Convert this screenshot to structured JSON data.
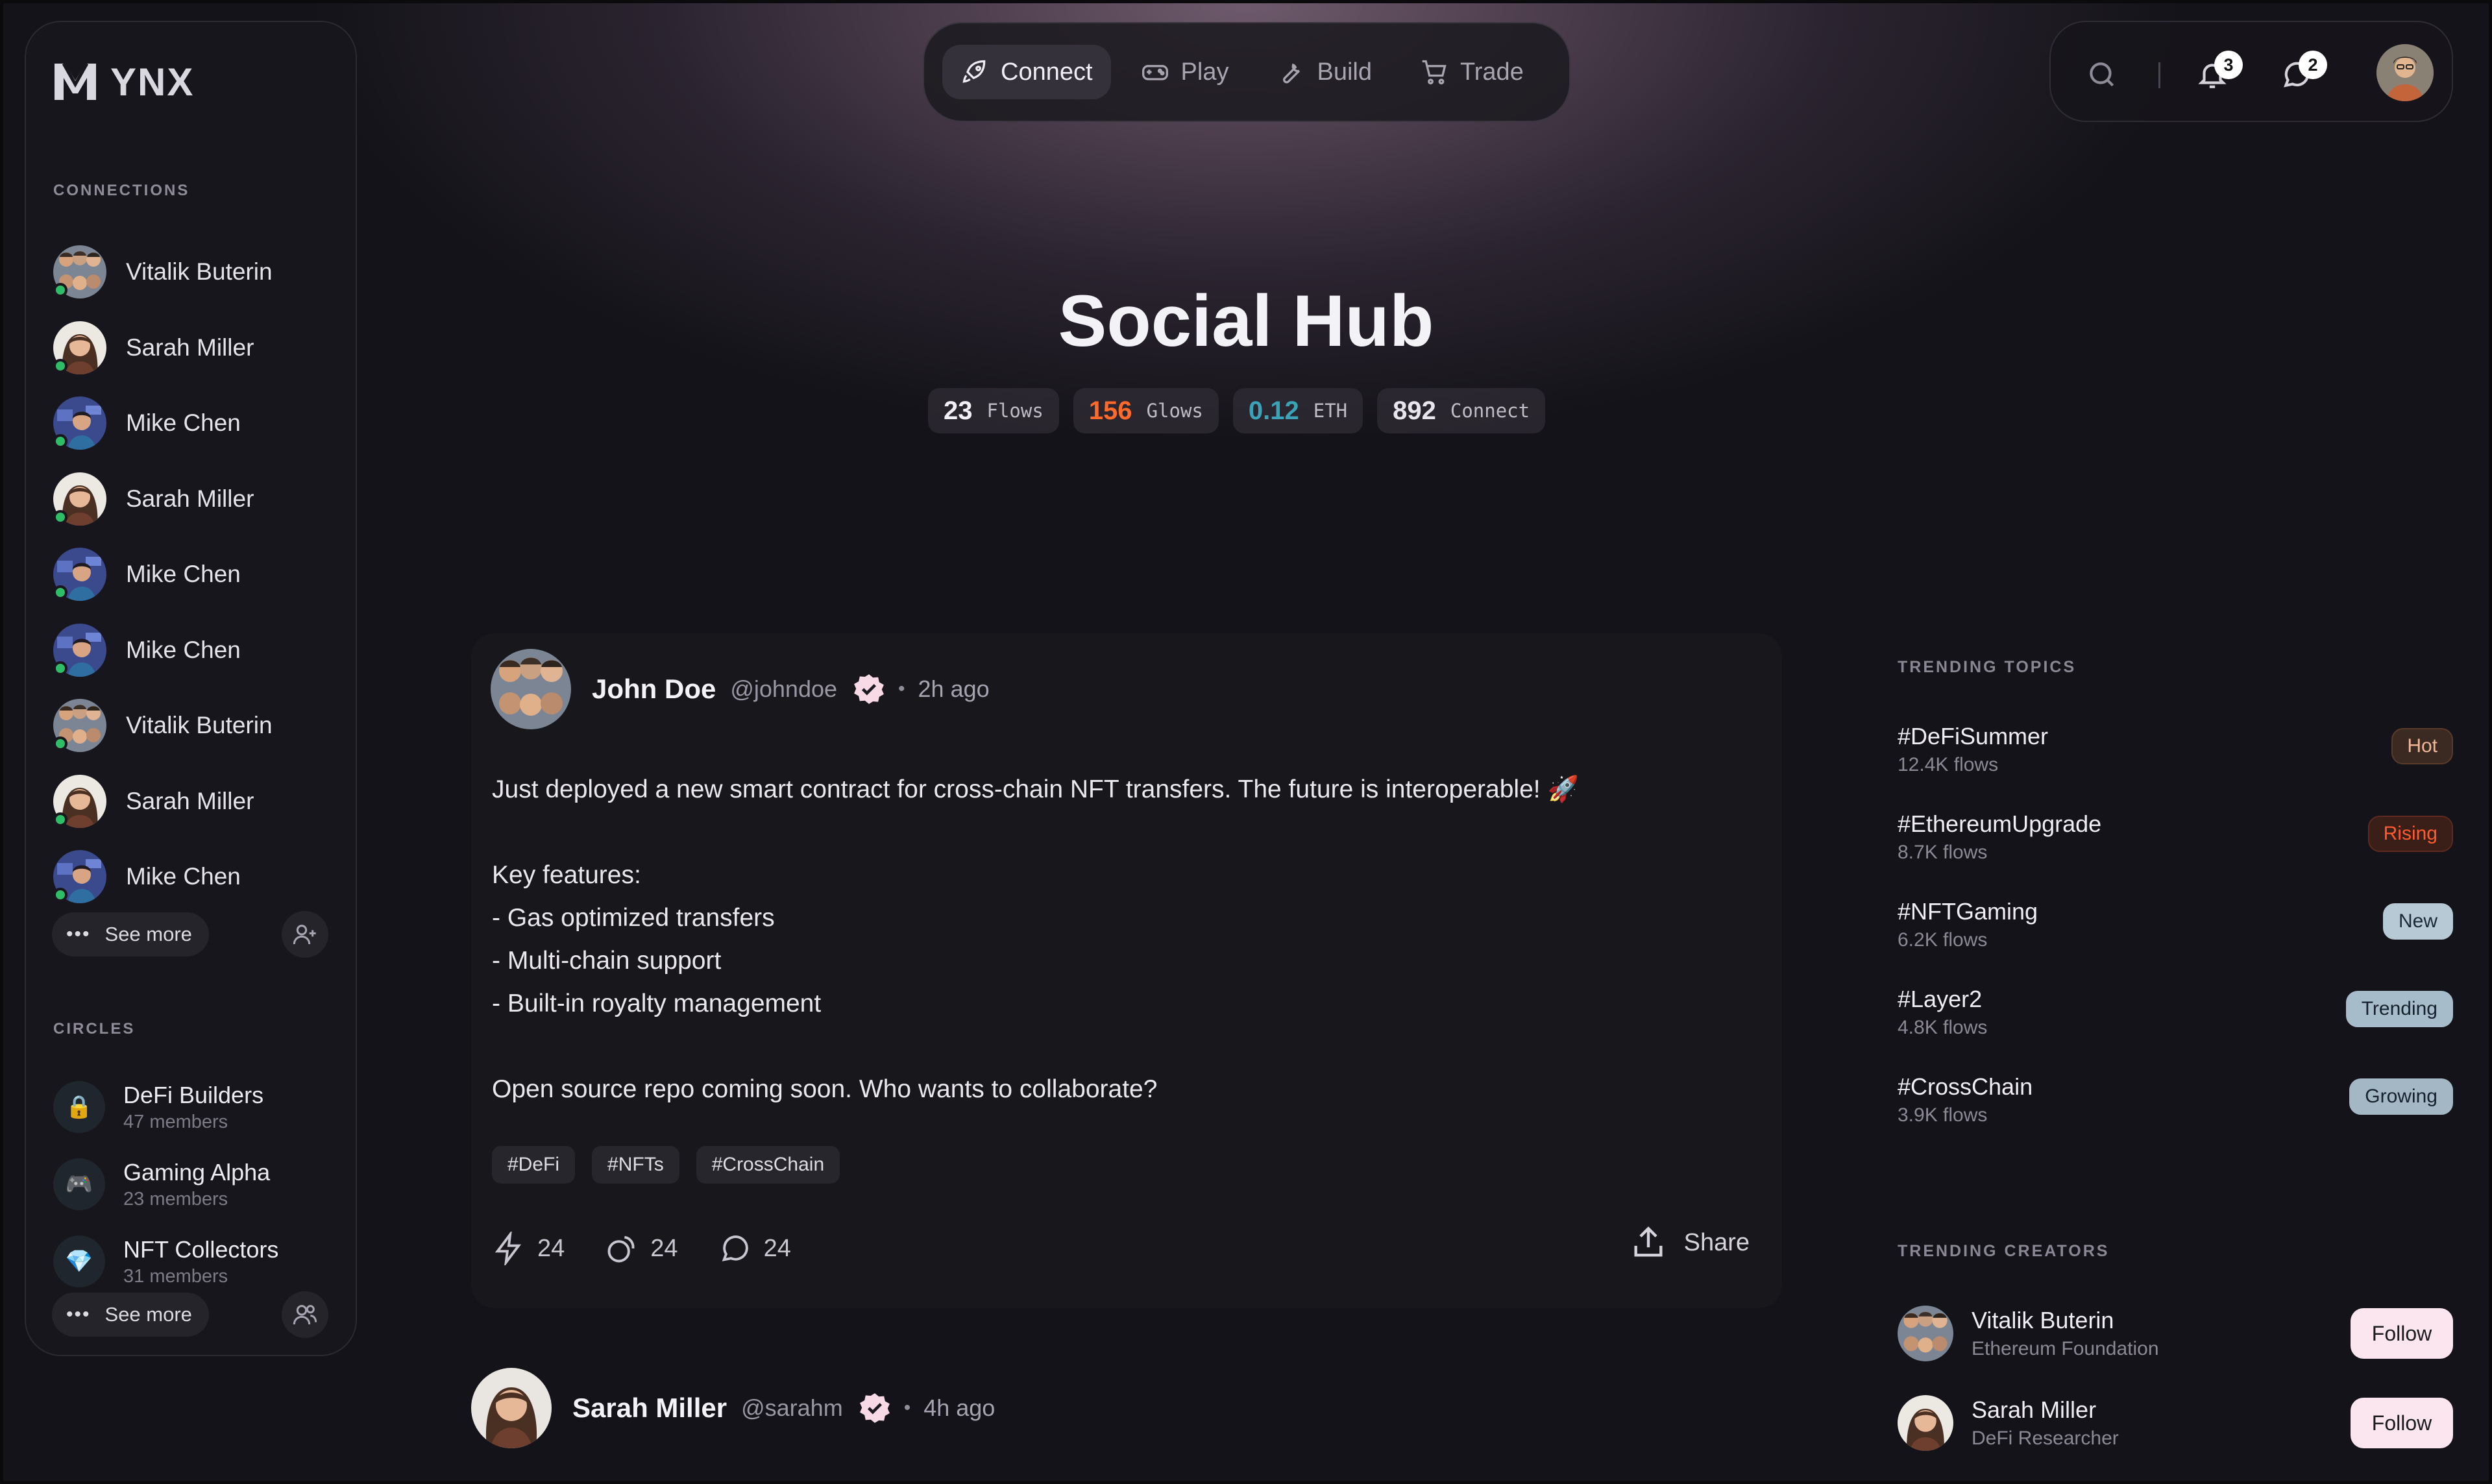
{
  "app": {
    "logo_text": "YNX"
  },
  "sidebar": {
    "connections_label": "CONNECTIONS",
    "connections": [
      {
        "name": "Vitalik Buterin",
        "avatar": "group"
      },
      {
        "name": "Sarah Miller",
        "avatar": "woman"
      },
      {
        "name": "Mike Chen",
        "avatar": "man"
      },
      {
        "name": "Sarah Miller",
        "avatar": "woman"
      },
      {
        "name": "Mike Chen",
        "avatar": "man"
      },
      {
        "name": "Mike Chen",
        "avatar": "man"
      },
      {
        "name": "Vitalik Buterin",
        "avatar": "group"
      },
      {
        "name": "Sarah Miller",
        "avatar": "woman"
      },
      {
        "name": "Mike Chen",
        "avatar": "man"
      }
    ],
    "see_more": "See more",
    "circles_label": "CIRCLES",
    "circles": [
      {
        "name": "DeFi Builders",
        "members": "47 members",
        "icon": "🔒"
      },
      {
        "name": "Gaming Alpha",
        "members": "23 members",
        "icon": "🎮"
      },
      {
        "name": "NFT Collectors",
        "members": "31 members",
        "icon": "💎"
      }
    ],
    "circles_see_more": "See more"
  },
  "nav": {
    "tabs": [
      {
        "label": "Connect",
        "icon": "rocket-icon",
        "active": true
      },
      {
        "label": "Play",
        "icon": "gamepad-icon",
        "active": false
      },
      {
        "label": "Build",
        "icon": "wrench-icon",
        "active": false
      },
      {
        "label": "Trade",
        "icon": "cart-icon",
        "active": false
      }
    ],
    "notifications_count": "3",
    "messages_count": "2"
  },
  "hero": {
    "title": "Social Hub",
    "stats": [
      {
        "value": "23",
        "label": "Flows",
        "color": "#f1f0f4"
      },
      {
        "value": "156",
        "label": "Glows",
        "color": "#ff6a2a"
      },
      {
        "value": "0.12",
        "label": "ETH",
        "color": "#3aa3b8"
      },
      {
        "value": "892",
        "label": "Connect",
        "color": "#e8e6ec"
      }
    ]
  },
  "post": {
    "author": "John Doe",
    "handle": "@johndoe",
    "time": "2h ago",
    "body": "Just deployed a new smart contract for cross-chain NFT transfers. The future is interoperable! 🚀\n\nKey features:\n- Gas optimized transfers\n- Multi-chain support\n- Built-in royalty management\n\nOpen source repo coming soon. Who wants to collaborate?",
    "tags": [
      "#DeFi",
      "#NFTs",
      "#CrossChain"
    ],
    "likes": "24",
    "reposts": "24",
    "comments": "24",
    "share_label": "Share"
  },
  "post2": {
    "author": "Sarah Miller",
    "handle": "@sarahm",
    "time": "4h ago"
  },
  "trending": {
    "label": "TRENDING TOPICS",
    "topics": [
      {
        "tag": "#DeFiSummer",
        "count": "12.4K flows",
        "badge": "Hot",
        "badge_bg": "#3b2a22",
        "badge_fg": "#f0b79a",
        "badge_border": "#5a3a2a"
      },
      {
        "tag": "#EthereumUpgrade",
        "count": "8.7K flows",
        "badge": "Rising",
        "badge_bg": "#3a1f19",
        "badge_fg": "#ff5a2e",
        "badge_border": "#5e2a1f"
      },
      {
        "tag": "#NFTGaming",
        "count": "6.2K flows",
        "badge": "New",
        "badge_bg": "#b8c9d6",
        "badge_fg": "#1b2a36",
        "badge_border": "#b8c9d6"
      },
      {
        "tag": "#Layer2",
        "count": "4.8K flows",
        "badge": "Trending",
        "badge_bg": "#a7bccb",
        "badge_fg": "#16232e",
        "badge_border": "#a7bccb"
      },
      {
        "tag": "#CrossChain",
        "count": "3.9K flows",
        "badge": "Growing",
        "badge_bg": "#a4b7c5",
        "badge_fg": "#16232e",
        "badge_border": "#a4b7c5"
      }
    ]
  },
  "creators": {
    "label": "TRENDING CREATORS",
    "list": [
      {
        "name": "Vitalik Buterin",
        "role": "Ethereum Foundation",
        "button": "Follow"
      },
      {
        "name": "Sarah Miller",
        "role": "DeFi Researcher",
        "button": "Follow"
      }
    ]
  }
}
